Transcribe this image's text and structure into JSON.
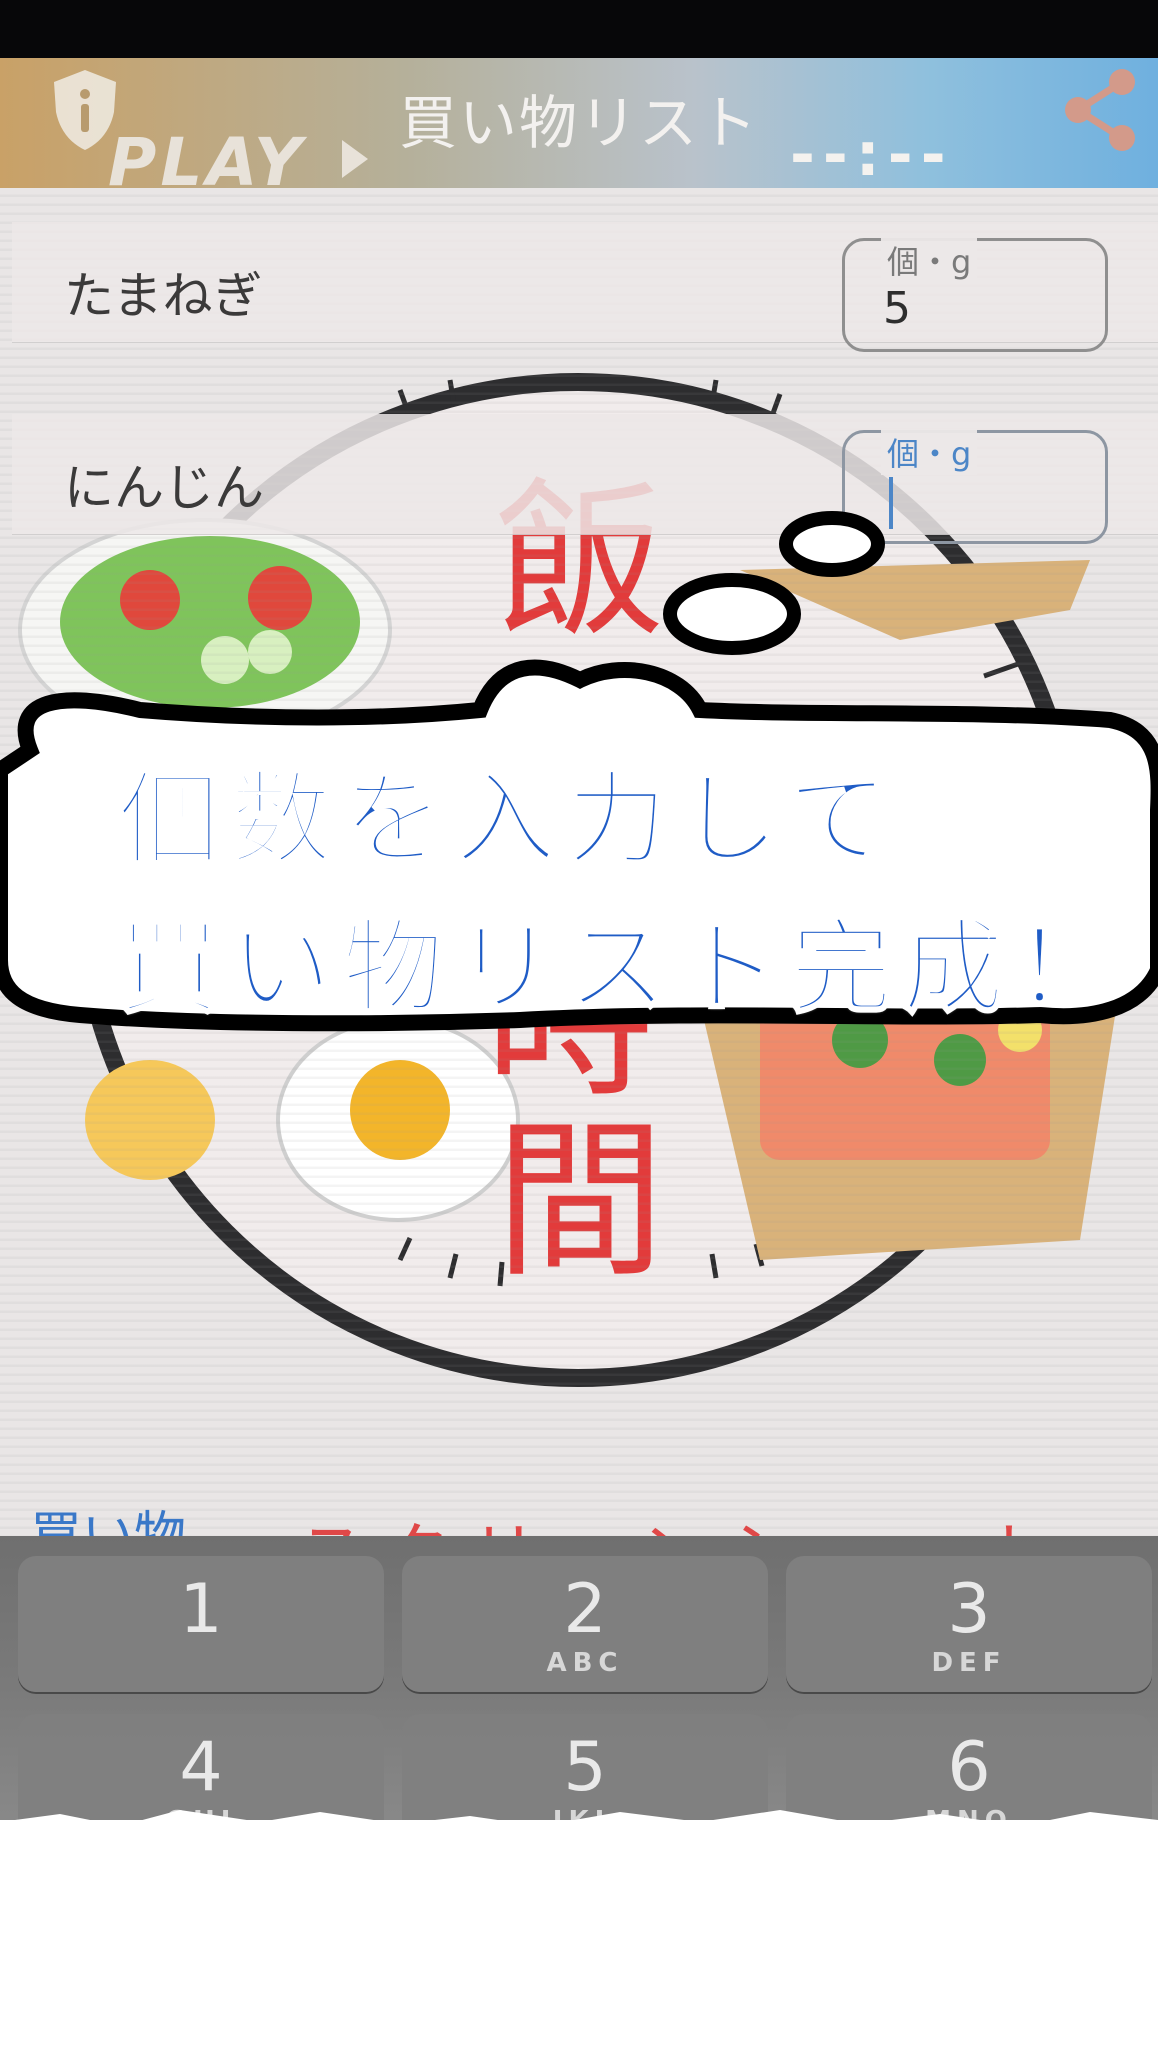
{
  "header": {
    "title": "買い物リスト",
    "play_label": "PLAY",
    "time_label": "--:--",
    "info_icon": "shield-info-icon",
    "share_icon": "share-icon"
  },
  "items": [
    {
      "label": "たまねぎ",
      "unit": "個・g",
      "value": "5"
    },
    {
      "label": "にんじん",
      "unit": "個・g",
      "value": ""
    }
  ],
  "illustration": {
    "clock_text_top": "飯",
    "clock_text_mid": "時",
    "clock_text_bottom": "間"
  },
  "bubble": {
    "line1": "個数を入力して",
    "line2": "買い物リスト完成！"
  },
  "behind_keyboard": {
    "left_text": "買い物",
    "mid_text": "スクリーンショット"
  },
  "keyboard": {
    "keys": [
      {
        "digit": "1",
        "letters": ""
      },
      {
        "digit": "2",
        "letters": "ABC"
      },
      {
        "digit": "3",
        "letters": "DEF"
      },
      {
        "digit": "4",
        "letters": "GHI"
      },
      {
        "digit": "5",
        "letters": "JKL"
      },
      {
        "digit": "6",
        "letters": "MNO"
      }
    ]
  }
}
